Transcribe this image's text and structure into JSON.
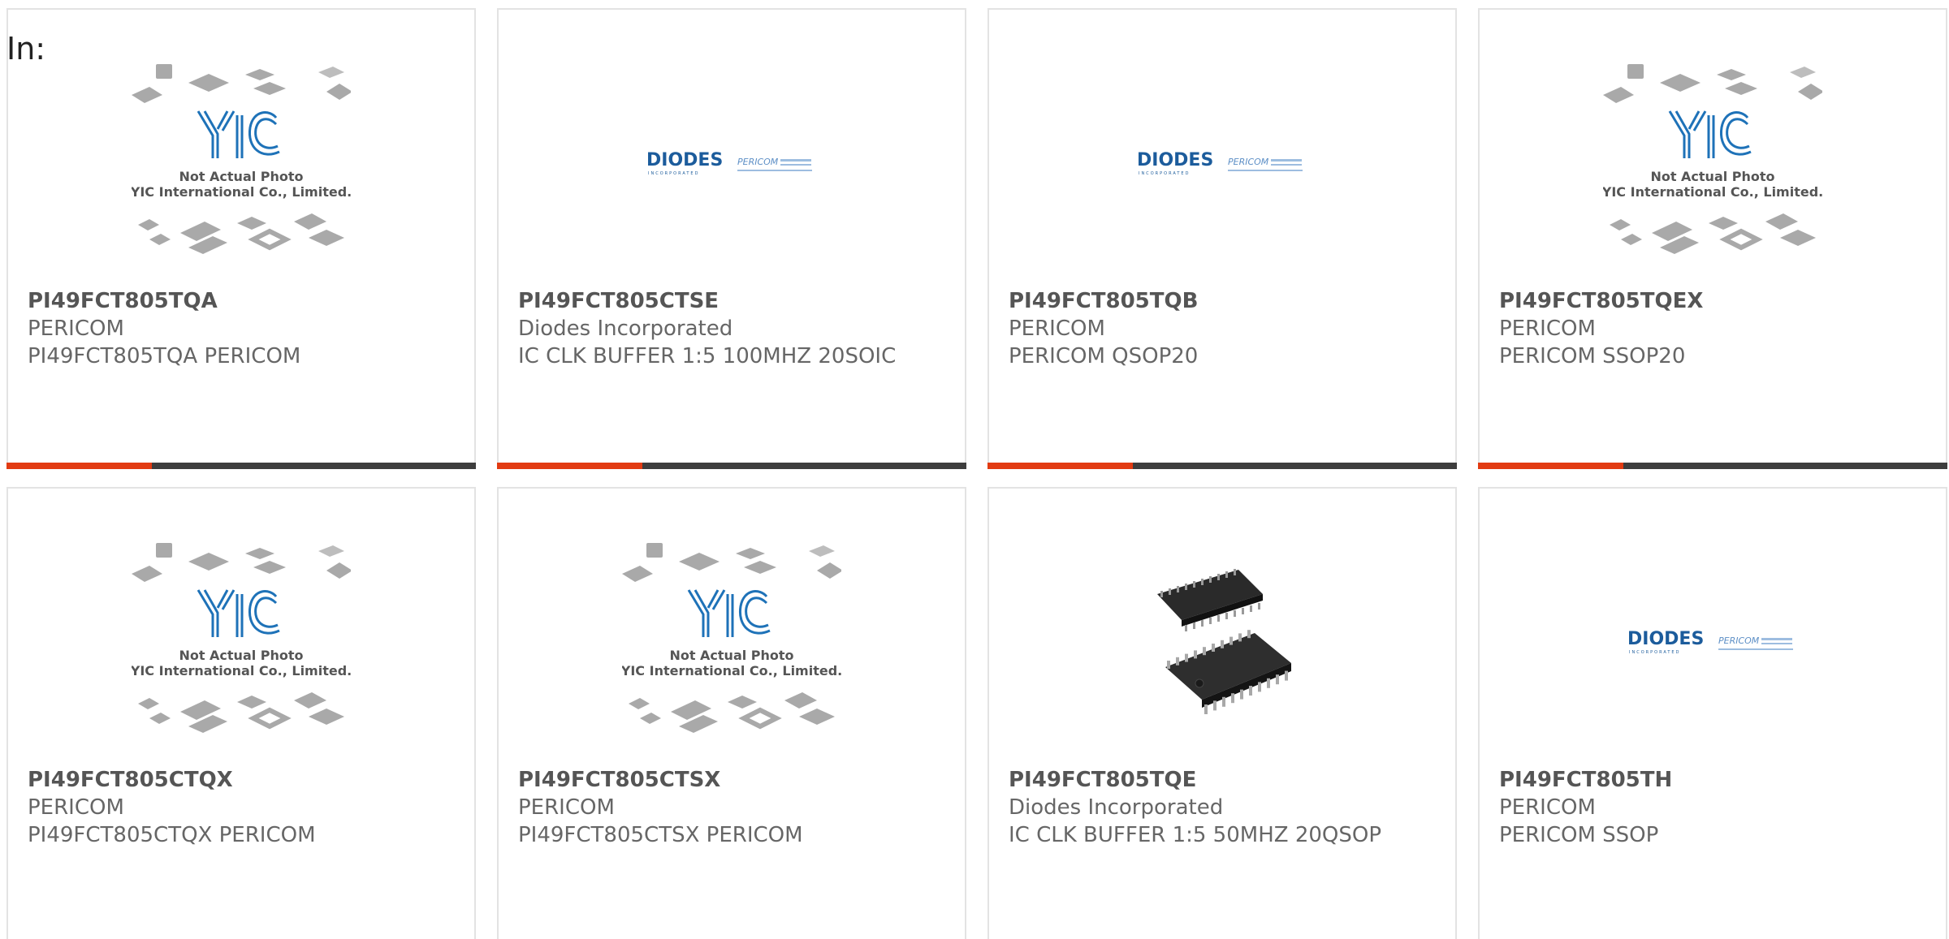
{
  "header": {
    "in_label": "In:"
  },
  "logo_text": {
    "not_actual_photo": "Not Actual Photo",
    "company": "YIC International Co., Limited.",
    "diodes": "DIODES",
    "diodes_sub": "INCORPORATED",
    "pericom": "PERICOM"
  },
  "colors": {
    "accent": "#e23b12",
    "bar": "#3d3d3d",
    "border": "#e3e3e3",
    "yic_blue": "#1e72b8"
  },
  "products": [
    {
      "part": "PI49FCT805TQA",
      "manufacturer": "PERICOM",
      "description": "PI49FCT805TQA PERICOM",
      "image": "yic-placeholder-icon"
    },
    {
      "part": "PI49FCT805CTSE",
      "manufacturer": "Diodes Incorporated",
      "description": "IC CLK BUFFER 1:5 100MHZ 20SOIC",
      "image": "diodes-pericom-logo"
    },
    {
      "part": "PI49FCT805TQB",
      "manufacturer": "PERICOM",
      "description": "PERICOM QSOP20",
      "image": "diodes-pericom-logo"
    },
    {
      "part": "PI49FCT805TQEX",
      "manufacturer": "PERICOM",
      "description": "PERICOM SSOP20",
      "image": "yic-placeholder-icon"
    },
    {
      "part": "PI49FCT805CTQX",
      "manufacturer": "PERICOM",
      "description": "PI49FCT805CTQX PERICOM",
      "image": "yic-placeholder-icon"
    },
    {
      "part": "PI49FCT805CTSX",
      "manufacturer": "PERICOM",
      "description": "PI49FCT805CTSX PERICOM",
      "image": "yic-placeholder-icon"
    },
    {
      "part": "PI49FCT805TQE",
      "manufacturer": "Diodes Incorporated",
      "description": "IC CLK BUFFER 1:5 50MHZ 20QSOP",
      "image": "ic-chip-photo"
    },
    {
      "part": "PI49FCT805TH",
      "manufacturer": "PERICOM",
      "description": "PERICOM SSOP",
      "image": "diodes-pericom-logo"
    }
  ]
}
